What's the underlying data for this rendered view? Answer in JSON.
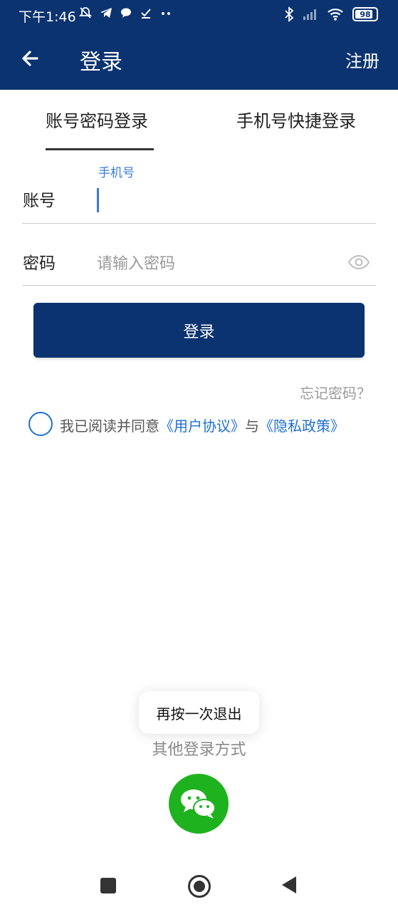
{
  "status_bar": {
    "time": "下午1:46",
    "battery": "98",
    "battery_fraction": 0.98,
    "icons": [
      "mute-bell-icon",
      "telegram-icon",
      "chat-bubble-icon",
      "check-icon",
      "more-dots-icon",
      "bluetooth-icon",
      "cellular-signal-icon",
      "wifi-icon",
      "battery-icon"
    ]
  },
  "app_bar": {
    "title": "登录",
    "action": "注册",
    "background": "#0b3370"
  },
  "tabs": [
    {
      "label": "账号密码登录",
      "active": true
    },
    {
      "label": "手机号快捷登录",
      "active": false
    }
  ],
  "form": {
    "account": {
      "label": "账号",
      "floating_label": "手机号",
      "value": ""
    },
    "password": {
      "label": "密码",
      "placeholder": "请输入密码"
    }
  },
  "login_button": "登录",
  "forgot_password": "忘记密码？",
  "agreement": {
    "text": "我已阅读并同意",
    "user_agreement": "《用户协议》",
    "conjunction": "与",
    "privacy_policy": "《隐私政策》",
    "link_color": "#1f6fd1"
  },
  "other_login": {
    "label": "其他登录方式",
    "wechat_color": "#1fb21f"
  },
  "toast": "再按一次退出"
}
